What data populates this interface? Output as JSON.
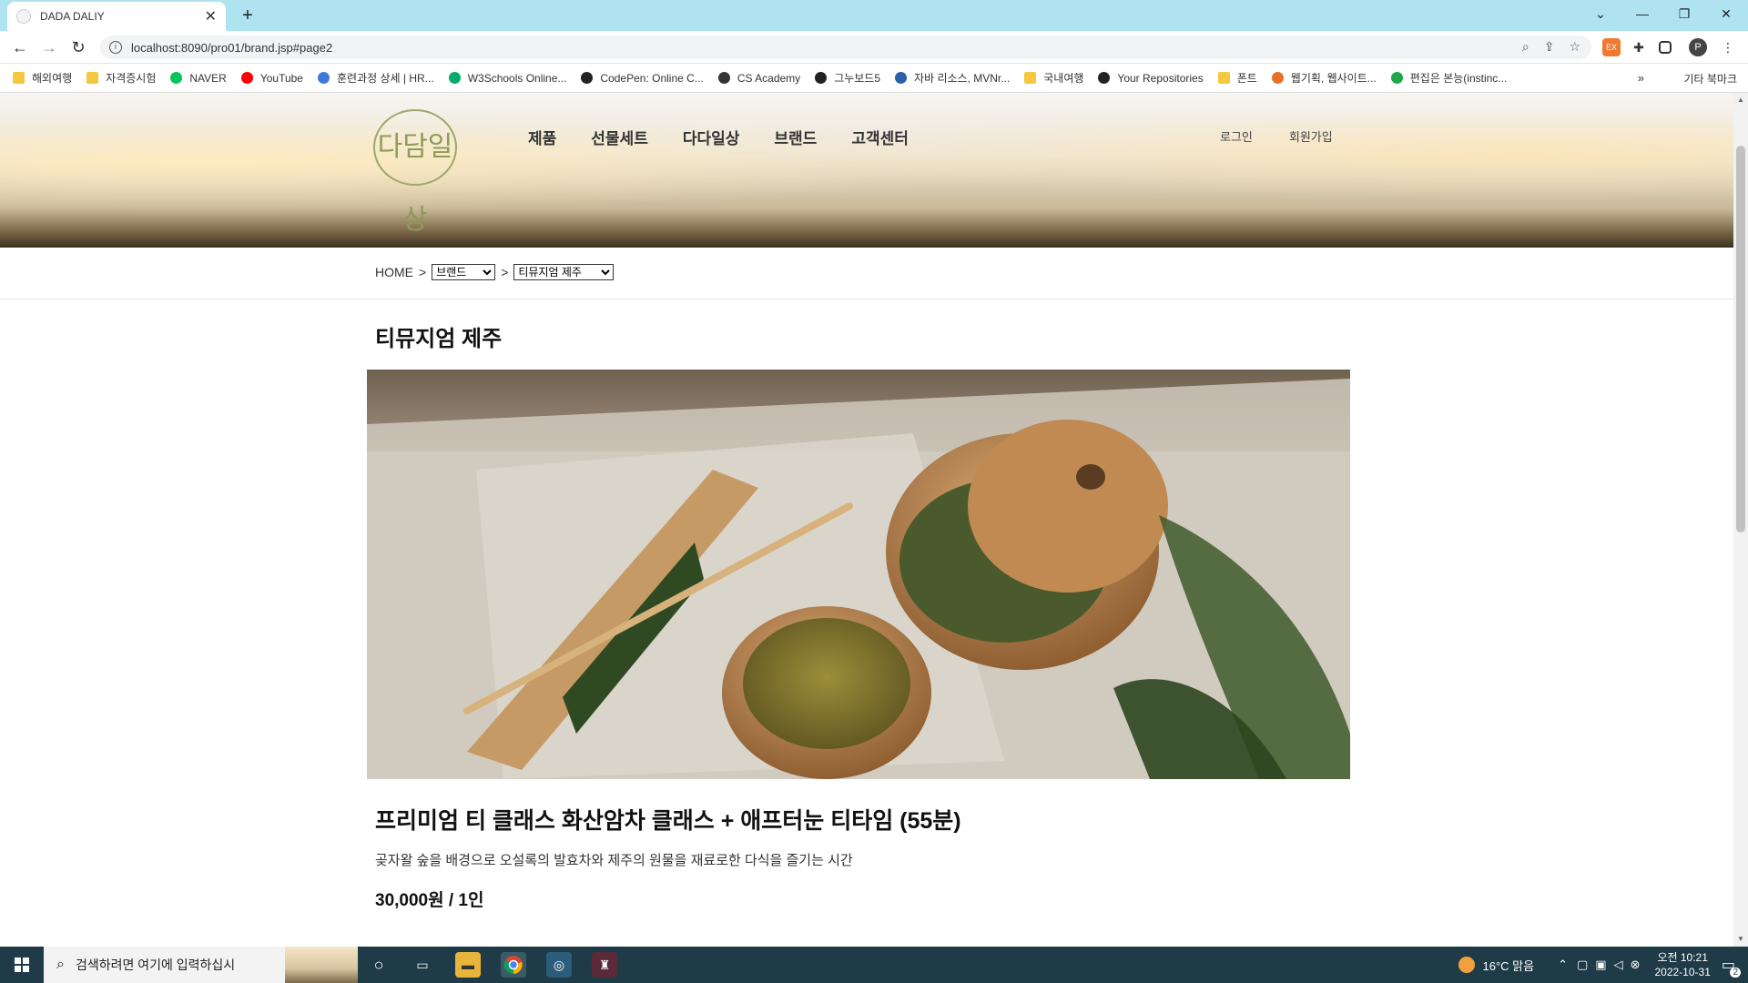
{
  "browser": {
    "tab_title": "DADA DALIY",
    "url": "localhost:8090/pro01/brand.jsp#page2",
    "bookmarks": [
      {
        "label": "해외여행",
        "icon": "folder-icon"
      },
      {
        "label": "자격증시험",
        "icon": "folder-icon"
      },
      {
        "label": "NAVER",
        "icon": "naver-icon"
      },
      {
        "label": "YouTube",
        "icon": "youtube-icon"
      },
      {
        "label": "훈련과정 상세 | HR...",
        "icon": "hrd-icon"
      },
      {
        "label": "W3Schools Online...",
        "icon": "w3schools-icon"
      },
      {
        "label": "CodePen: Online C...",
        "icon": "codepen-icon"
      },
      {
        "label": "CS Academy",
        "icon": "csacademy-icon"
      },
      {
        "label": "그누보드5",
        "icon": "gnuboard-icon"
      },
      {
        "label": "자바 리소스, MVNr...",
        "icon": "mvn-icon"
      },
      {
        "label": "국내여행",
        "icon": "folder-icon"
      },
      {
        "label": "Your Repositories",
        "icon": "github-icon"
      },
      {
        "label": "폰트",
        "icon": "folder-icon"
      },
      {
        "label": "웹기획, 웹사이트...",
        "icon": "web-icon"
      },
      {
        "label": "편집은 본능(instinc...",
        "icon": "edit-icon"
      }
    ],
    "other_bookmarks": "기타 북마크",
    "more": "»"
  },
  "site": {
    "logo_text": "다담일상",
    "gnb": [
      "제품",
      "선물세트",
      "다다일상",
      "브랜드",
      "고객센터"
    ],
    "util": [
      "로그인",
      "회원가입"
    ]
  },
  "breadcrumb": {
    "home": "HOME",
    "sep": ">",
    "select1": "브랜드",
    "select2": "티뮤지엄 제주"
  },
  "content": {
    "page_title": "티뮤지엄 제주",
    "class_title": "프리미엄 티 클래스 화산암차 클래스 + 애프터눈 티타임 (55분)",
    "class_desc": "곶자왈 숲을 배경으로 오설록의 발효차와 제주의 원물을 재료로한 다식을 즐기는 시간",
    "class_price": "30,000원 / 1인"
  },
  "taskbar": {
    "search_placeholder": "검색하려면 여기에 입력하십시",
    "weather": "16°C  맑음",
    "time": "오전 10:21",
    "date": "2022-10-31",
    "notif_count": "2"
  },
  "colors": {
    "tabbar": "#aee3ef",
    "taskbar": "#1f3b48",
    "logo": "#8f9a58"
  }
}
